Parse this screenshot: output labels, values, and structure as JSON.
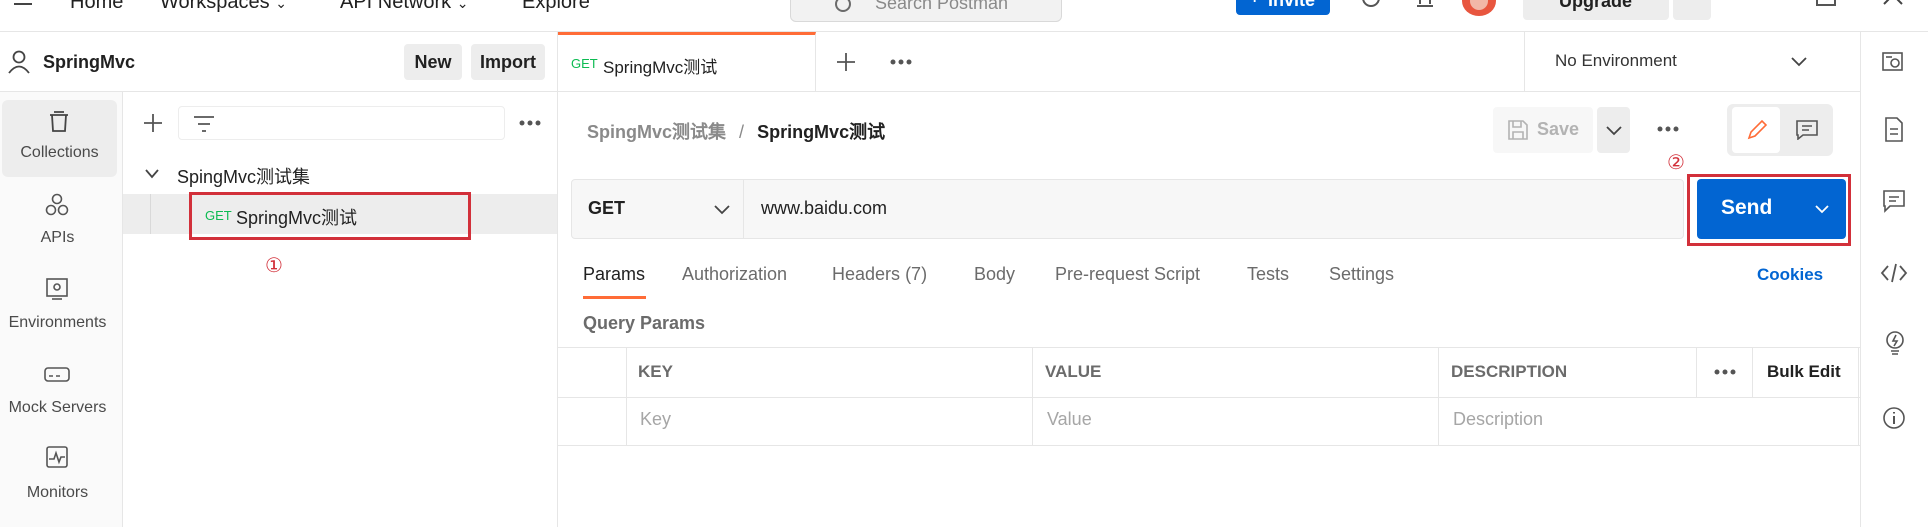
{
  "header": {
    "nav": [
      "Home",
      "Workspaces",
      "API Network",
      "Explore"
    ],
    "search_placeholder": "Search Postman",
    "invite_label": "Invite",
    "upgrade_label": "Upgrade"
  },
  "sidebar": {
    "workspace_name": "SpringMvc",
    "new_label": "New",
    "import_label": "Import",
    "rail": [
      {
        "label": "Collections",
        "icon": "collections-icon"
      },
      {
        "label": "APIs",
        "icon": "apis-icon"
      },
      {
        "label": "Environments",
        "icon": "environments-icon"
      },
      {
        "label": "Mock Servers",
        "icon": "mock-servers-icon"
      },
      {
        "label": "Monitors",
        "icon": "monitors-icon"
      }
    ],
    "collection_name": "SpingMvc测试集",
    "request_method": "GET",
    "request_name": "SpringMvc测试",
    "annotation_1": "①"
  },
  "tabs": {
    "active_method": "GET",
    "active_name": "SpringMvc测试",
    "environment": "No Environment"
  },
  "request": {
    "breadcrumb_parent": "SpingMvc测试集",
    "breadcrumb_sep": "/",
    "breadcrumb_current": "SpringMvc测试",
    "save_label": "Save",
    "method": "GET",
    "url": "www.baidu.com",
    "send_label": "Send",
    "annotation_2": "②",
    "param_tabs": [
      "Params",
      "Authorization",
      "Headers",
      "Body",
      "Pre-request Script",
      "Tests",
      "Settings"
    ],
    "headers_count": "(7)",
    "cookies_label": "Cookies",
    "query_params_title": "Query Params",
    "table": {
      "headers": [
        "KEY",
        "VALUE",
        "DESCRIPTION"
      ],
      "bulk_edit": "Bulk Edit",
      "placeholders": [
        "Key",
        "Value",
        "Description"
      ]
    }
  },
  "colors": {
    "accent": "#ff6c37",
    "primary": "#0265d2",
    "annotation": "#d2303a",
    "method_get": "#0cbb52"
  }
}
